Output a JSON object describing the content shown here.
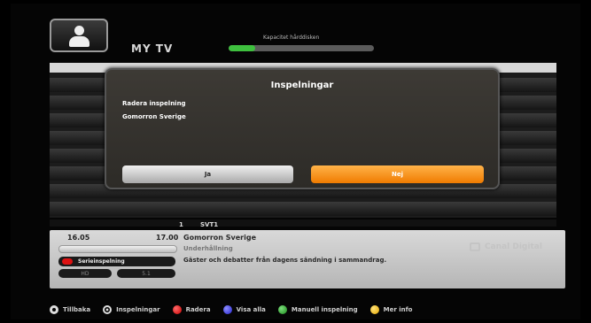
{
  "header": {
    "section_title": "MY TV",
    "capacity_label": "Kapacitet hårddisken",
    "capacity_used_fraction": 0.18,
    "avatar_icon": "user-avatar-icon"
  },
  "dialog": {
    "title": "Inspelningar",
    "line1": "Radera inspelning",
    "line2": "Gomorron Sverige",
    "yes_label": "Ja",
    "no_label": "Nej",
    "selected": "Nej"
  },
  "channel": {
    "number": "1",
    "name": "SVT1"
  },
  "program": {
    "start_time": "16.05",
    "end_time": "17.00",
    "title": "Gomorron Sverige",
    "genre": "Underhållning",
    "description": "Gäster och debatter från dagens sändning i sammandrag.",
    "series_label": "Serieinspelning",
    "tag_hd": "HD",
    "tag_audio": "5.1",
    "provider_logo": "Canal Digital"
  },
  "footer": [
    {
      "icon": "back-icon",
      "label": "Tillbaka"
    },
    {
      "icon": "record-icon",
      "label": "Inspelningar"
    },
    {
      "icon": "red-button-icon",
      "label": "Radera"
    },
    {
      "icon": "blue-button-icon",
      "label": "Visa alla"
    },
    {
      "icon": "green-button-icon",
      "label": "Manuell inspelning"
    },
    {
      "icon": "yellow-button-icon",
      "label": "Mer info"
    }
  ],
  "colors": {
    "accent_orange": "#f07b00",
    "capacity_green": "#3ec03e"
  }
}
